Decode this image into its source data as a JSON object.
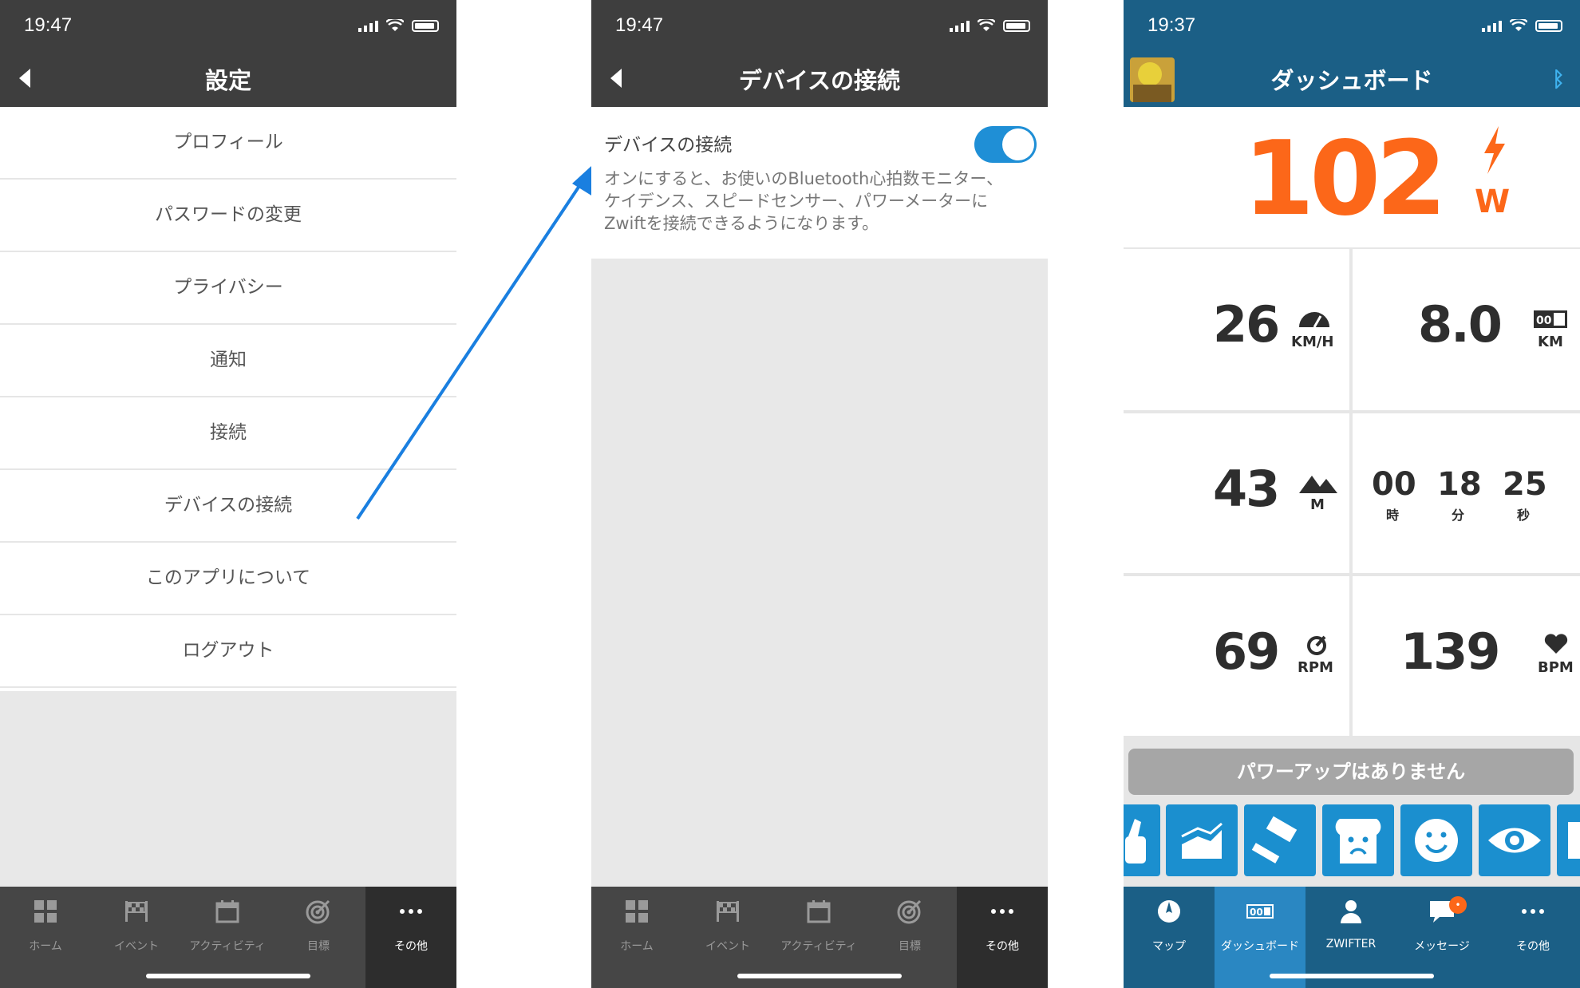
{
  "colors": {
    "dark_bar": "#3e3e3e",
    "zwift_blue": "#1b5f86",
    "power_orange": "#fc6719",
    "toggle_blue": "#1f8fd6",
    "tab_active_blue": "#2a87c2"
  },
  "panel1": {
    "status_time": "19:47",
    "nav_title": "設定",
    "menu": [
      "プロフィール",
      "パスワードの変更",
      "プライバシー",
      "通知",
      "接続",
      "デバイスの接続",
      "このアプリについて",
      "ログアウト"
    ]
  },
  "panel2": {
    "status_time": "19:47",
    "nav_title": "デバイスの接続",
    "toggle_label": "デバイスの接続",
    "toggle_on": true,
    "description_lines": [
      "オンにすると、お使いのBluetooth心拍数モニター、",
      "ケイデンス、スピードセンサー、パワーメーターに",
      "Zwiftを接続できるようになります。"
    ]
  },
  "tabs_settings": [
    {
      "label": "ホーム",
      "icon": "grid-icon"
    },
    {
      "label": "イベント",
      "icon": "flag-icon"
    },
    {
      "label": "アクティビティ",
      "icon": "calendar-icon"
    },
    {
      "label": "目標",
      "icon": "target-icon"
    },
    {
      "label": "その他",
      "icon": "more-icon"
    }
  ],
  "panel3": {
    "status_time": "19:37",
    "nav_title": "ダッシュボード",
    "power": {
      "value": "102",
      "unit": "W"
    },
    "speed": {
      "value": "26",
      "unit": "KM/H"
    },
    "distance": {
      "value": "8.0",
      "unit": "KM"
    },
    "elevation": {
      "value": "43",
      "unit": "M"
    },
    "time": {
      "h": "00",
      "h_lbl": "時",
      "m": "18",
      "m_lbl": "分",
      "s": "25",
      "s_lbl": "秒"
    },
    "cadence": {
      "value": "69",
      "unit": "RPM"
    },
    "heartrate": {
      "value": "139",
      "unit": "BPM"
    },
    "powerup_text": "パワーアップはありません",
    "tabs": [
      {
        "label": "マップ",
        "icon": "compass-icon"
      },
      {
        "label": "ダッシュボード",
        "icon": "dashboard-icon"
      },
      {
        "label": "ZWIFTER",
        "icon": "person-icon"
      },
      {
        "label": "メッセージ",
        "icon": "message-icon"
      },
      {
        "label": "その他",
        "icon": "more-icon"
      }
    ]
  }
}
